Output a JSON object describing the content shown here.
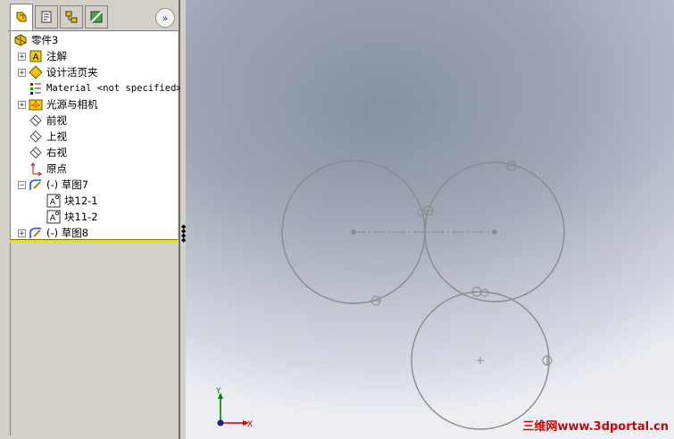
{
  "feature_manager": {
    "tabs": [
      {
        "name": "feature-manager-tab",
        "icon": "feature-tree-icon"
      },
      {
        "name": "property-manager-tab",
        "icon": "property-icon"
      },
      {
        "name": "configuration-manager-tab",
        "icon": "configuration-icon"
      },
      {
        "name": "display-manager-tab",
        "icon": "display-icon"
      }
    ],
    "more_tabs_label": "»",
    "tree": {
      "root": "零件3",
      "items": [
        {
          "label": "注解",
          "icon": "annotation-icon",
          "expander": "+"
        },
        {
          "label": "设计活页夹",
          "icon": "design-binder-icon",
          "expander": "+"
        },
        {
          "label": "Material <not specified>",
          "icon": "material-icon",
          "expander": ""
        },
        {
          "label": "光源与相机",
          "icon": "lights-cameras-icon",
          "expander": "+"
        },
        {
          "label": "前视",
          "icon": "plane-icon",
          "expander": ""
        },
        {
          "label": "上视",
          "icon": "plane-icon",
          "expander": ""
        },
        {
          "label": "右视",
          "icon": "plane-icon",
          "expander": ""
        },
        {
          "label": "原点",
          "icon": "origin-icon",
          "expander": ""
        },
        {
          "label": "(-) 草图7",
          "icon": "sketch-icon",
          "expander": "−"
        },
        {
          "label": "块12-1",
          "icon": "block-icon",
          "expander": ""
        },
        {
          "label": "块11-2",
          "icon": "block-icon",
          "expander": ""
        },
        {
          "label": "(-) 草图8",
          "icon": "sketch-icon",
          "expander": "+"
        }
      ]
    }
  },
  "viewport": {
    "triad": {
      "y_label": "Y",
      "x_label": "X",
      "z_color": "#1a237e",
      "x_color": "#cc0000",
      "y_color": "#008000"
    },
    "sketch_color": "#8a8a8a",
    "watermark": "三维网www.3dportal.cn"
  }
}
